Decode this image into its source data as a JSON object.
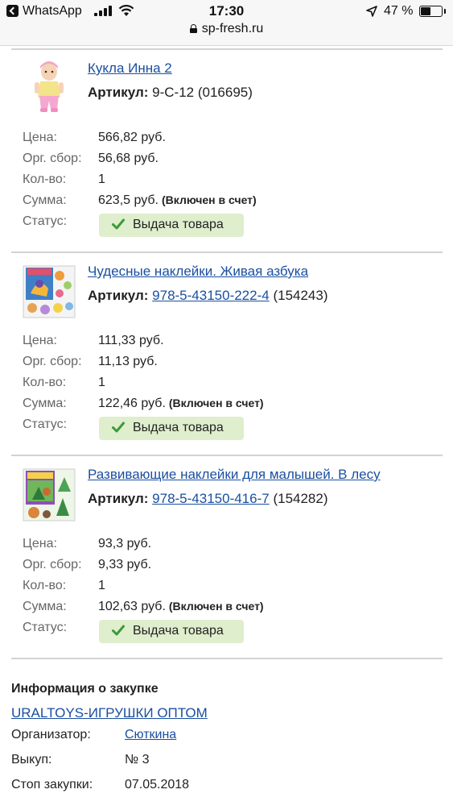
{
  "status_bar": {
    "back_app": "WhatsApp",
    "time": "17:30",
    "battery": "47 %",
    "url": "sp-fresh.ru"
  },
  "labels": {
    "price": "Цена:",
    "fee": "Орг. сбор:",
    "qty": "Кол-во:",
    "sum": "Сумма:",
    "status": "Статус:",
    "article": "Артикул:"
  },
  "items": [
    {
      "title": "Кукла Инна 2",
      "article_code": "9-С-12",
      "article_code_is_link": false,
      "article_id": "(016695)",
      "price": "566,82 руб.",
      "fee": "56,68 руб.",
      "qty": "1",
      "sum": "623,5 руб.",
      "sum_note": "(Включен в счет)",
      "status": "Выдача товара"
    },
    {
      "title": "Чудесные наклейки. Живая азбука",
      "article_code": "978-5-43150-222-4",
      "article_code_is_link": true,
      "article_id": "(154243)",
      "price": "111,33 руб.",
      "fee": "11,13 руб.",
      "qty": "1",
      "sum": "122,46 руб.",
      "sum_note": "(Включен в счет)",
      "status": "Выдача товара"
    },
    {
      "title": "Развивающие наклейки для малышей. В лесу",
      "article_code": "978-5-43150-416-7",
      "article_code_is_link": true,
      "article_id": "(154282)",
      "price": "93,3 руб.",
      "fee": "9,33 руб.",
      "qty": "1",
      "sum": "102,63 руб.",
      "sum_note": "(Включен в счет)",
      "status": "Выдача товара"
    }
  ],
  "purchase_info": {
    "title": "Информация о закупке",
    "shop_link": "URALTOYS-ИГРУШКИ ОПТОМ",
    "organizer_label": "Организатор:",
    "organizer_value": "Сюткина",
    "buyout_label": "Выкуп:",
    "buyout_value": "№ 3",
    "stop_label": "Стоп закупки:",
    "stop_value": "07.05.2018"
  },
  "colors": {
    "link": "#1a4fa0",
    "status_badge_bg": "#dfeecd",
    "check_green": "#3c9a3a"
  }
}
